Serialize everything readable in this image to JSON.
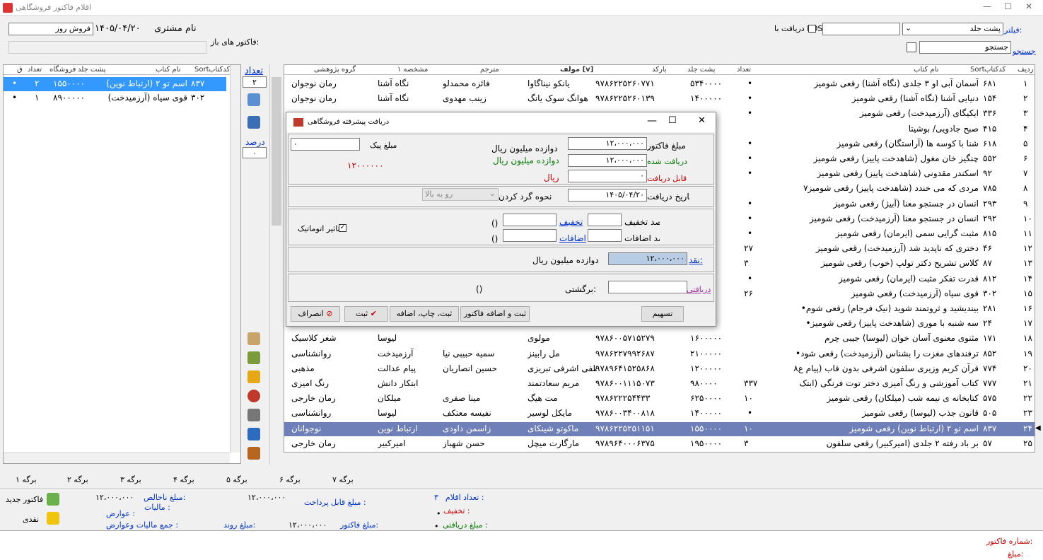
{
  "window": {
    "title": "اقلام فاکتور فروشگاهی",
    "minimize": "—",
    "maximize": "☐",
    "close": "✕"
  },
  "top": {
    "filter_label": "فیلتر:",
    "filter_value": "پشت جلد",
    "filter_text": "",
    "pos_label": "دریافت با POS",
    "day_sale": "فروش روز",
    "date": "۱۴۰۵/۰۴/۲۰",
    "customer_label": "نام مشتری",
    "open_invoices": "فاکتور های باز:",
    "search_label": "جستجو",
    "search_placeholder": "جستجو"
  },
  "main_grid": {
    "headers": [
      "ردیف",
      "کدکتاب",
      "Sort",
      "نام کتاب",
      "تعداد",
      "پشت جلد",
      "بارکد",
      "مولف [v]",
      "مترجم",
      "مشخصه ۱",
      "گروه پژوهشی"
    ],
    "rows": [
      [
        "۱",
        "۶۸۱",
        "آسمان آبی او ۳ جلدی (نگاه آشنا) رقعی شومیز",
        "",
        "۵۳۴۰۰۰۰",
        "۹۷۸۶۲۲۵۲۶۰۷۷۱",
        "یانکو نیناگاوا",
        "فائزه محمدلو",
        "نگاه آشنا",
        "رمان نوجوان",
        "•"
      ],
      [
        "۲",
        "۱۵۴",
        "دنیایی آشنا (نگاه آشنا) رقعی شومیز",
        "",
        "۱۴۰۰۰۰۰",
        "۹۷۸۶۲۲۵۲۶۰۱۳۹",
        "هوانگ سوک یانگ",
        "زینب مهدوی",
        "نگاه آشنا",
        "رمان نوجوان",
        "•"
      ],
      [
        "۳",
        "۳۳۶",
        "ایکیگای (آرزمیدخت) رقعی شومیز",
        "",
        "",
        "",
        "",
        "",
        "",
        "",
        "•"
      ],
      [
        "۴",
        "۴۱۵",
        "صبح جادویی/ بوشیتا",
        "",
        "",
        "",
        "",
        "",
        "",
        "",
        ""
      ],
      [
        "۵",
        "۶۱۸",
        "شنا با کوسه ها (آراستگان) رقعی شومیز",
        "",
        "",
        "",
        "",
        "",
        "",
        "",
        "•"
      ],
      [
        "۶",
        "۵۵۲",
        "چنگیز خان مغول (شاهدخت پاییز) رقعی شومیز",
        "",
        "",
        "",
        "",
        "",
        "",
        "",
        "•"
      ],
      [
        "۷",
        "۹۲",
        "اسکندر مقدونی (شاهدخت پاییز) رقعی شومیز",
        "",
        "",
        "",
        "",
        "",
        "",
        "",
        "•"
      ],
      [
        "۸",
        "۷۸۵",
        "مردی که می خندد (شاهدخت پاییز) رقعی شومیز۷",
        "",
        "",
        "",
        "",
        "",
        "",
        "",
        ""
      ],
      [
        "۹",
        "۲۹۳",
        "انسان در جستجو معنا (آبیژ) رقعی شومیز",
        "",
        "",
        "",
        "",
        "",
        "",
        "",
        "•"
      ],
      [
        "۱۰",
        "۲۹۲",
        "انسان در جستجو معنا (آرزمیدخت) رقعی شومیز",
        "",
        "",
        "",
        "",
        "",
        "",
        "",
        "•"
      ],
      [
        "۱۱",
        "۸۱۵",
        "مثبت گرایی سمی (ایرمان) رقعی شومیز",
        "",
        "",
        "",
        "",
        "",
        "",
        "",
        "•"
      ],
      [
        "۱۲",
        "۴۶",
        "دختری که ناپدید شد (آرزمیدخت) رقعی شومیز",
        "۲۷",
        "",
        "",
        "",
        "",
        "",
        "",
        ""
      ],
      [
        "۱۳",
        "۸۷",
        "کلاس تشریح دکتر تولپ (خوب) رقعی شومیز",
        "۳",
        "",
        "",
        "",
        "",
        "",
        "",
        ""
      ],
      [
        "۱۴",
        "۸۱۲",
        "قدرت تفکر مثبت (ایرمان) رقعی شومیز",
        "",
        "",
        "",
        "",
        "",
        "",
        "",
        "•"
      ],
      [
        "۱۵",
        "۳۰۲",
        "قوی سیاه (آرزمیدخت) رقعی شومیز",
        "۲۶",
        "",
        "",
        "",
        "",
        "",
        "",
        ""
      ],
      [
        "۱۶",
        "۲۸۱",
        "بیندیشید و ثروتمند شوید (نیک فرجام) رقعی شوم•",
        "",
        "",
        "",
        "",
        "",
        "",
        "",
        ""
      ],
      [
        "۱۷",
        "۲۴",
        "سه شنبه با موری (شاهدخت پاییز) رقعی شومیز•",
        "",
        "",
        "",
        "",
        "",
        "",
        "",
        ""
      ],
      [
        "۱۸",
        "۱۷۱",
        "مثنوی معنوی آسان خوان (لیوسا) جیبی چرم",
        "",
        "۱۶۰۰۰۰۰",
        "۹۷۸۶۰۰۵۷۱۵۲۷۹",
        "مولوی",
        "",
        "لیوسا",
        "شعر کلاسیک",
        ""
      ],
      [
        "۱۹",
        "۸۵۲",
        "ترفندهای مغزت را بشناس (آرزمیدخت) رقعی شود•",
        "",
        "۲۱۰۰۰۰۰",
        "۹۷۸۶۲۲۷۹۹۲۶۸۷",
        "مل رابینز",
        "سمیه حبیبی نیا",
        "آرزمیدخت",
        "روانشناسی",
        ""
      ],
      [
        "۲۰",
        "۷۷۴",
        "قرآن کریم وزیری سلفون اشرفی بدون قاب (پیام ع۸",
        "",
        "۱۲۰۰۰۰۰",
        "۹۷۸۹۶۴۱۵۲۵۸۶۸",
        "مصطفی اشرفی تبریزی",
        "حسین انصاریان",
        "پیام عدالت",
        "مذهبی",
        ""
      ],
      [
        "۲۱",
        "۷۷۷",
        "کتاب آموزشی و رنگ آمیزی دختر توت فرنگی (ابتک",
        "۳۳۷",
        "۹۸۰۰۰۰",
        "۹۷۸۶۰۰۱۱۱۵۰۷۳",
        "مریم سعادتمند",
        "",
        "ابتکار دانش",
        "رنگ امیزی",
        ""
      ],
      [
        "۲۲",
        "۵۷۵",
        "کتابخانه ی نیمه شب (میلکان) رقعی شومیز",
        "۱۰",
        "۶۲۵۰۰۰۰",
        "۹۷۸۶۲۲۲۵۴۴۳۳",
        "مت هیگ",
        "مینا صفری",
        "میلکان",
        "رمان خارجی",
        ""
      ],
      [
        "۲۳",
        "۵۰۵",
        "قانون جذب (لیوسا) رقعی شومیز",
        "",
        "۱۴۰۰۰۰۰",
        "۹۷۸۶۰۰۳۴۰۰۸۱۸",
        "مایکل لوسیر",
        "نفیسه معتکف",
        "لیوسا",
        "روانشناسی",
        "•"
      ],
      [
        "۲۴",
        "۸۳۷",
        "اسم تو ۲ (ارتباط نوین) رقعی شومیز",
        "۱۰",
        "۱۵۵۰۰۰۰",
        "۹۷۸۶۲۲۵۲۵۱۱۵۱",
        "ماکوتو شینکای",
        "زاسمن داودی",
        "ارتباط نوین",
        "نوجوانان",
        ""
      ],
      [
        "۲۵",
        "۵۷",
        "بر باد رفته ۲ جلدی (امیرکبیر) رقعی سلفون",
        "۳",
        "۱۹۵۰۰۰۰",
        "۹۷۸۹۶۴۰۰۰۶۳۷۵",
        "مارگارت میچل",
        "حسن شهباز",
        "امیرکبیر",
        "رمان خارجی",
        ""
      ]
    ]
  },
  "side": {
    "count_label": "تعداد",
    "count_value": "۲",
    "percent_label": "درصد",
    "percent_value": "۰"
  },
  "cart": {
    "headers": [
      "کدکتاب",
      "Sort",
      "نام کتاب",
      "پشت جلد",
      "فروشگاه",
      "تعداد",
      "ق"
    ],
    "rows": [
      [
        "۸۳۷",
        "اسم تو ۲ (ارتباط نوین)",
        "۱۵۵۰۰۰۰",
        "۲",
        "•"
      ],
      [
        "۳۰۲",
        "قوی سیاه (آرزمیدخت)",
        "۸۹۰۰۰۰۰",
        "۱",
        "•"
      ]
    ]
  },
  "tabs": [
    "برگه ۱",
    "برگه ۲",
    "برگه ۳",
    "برگه ۴",
    "برگه ۵",
    "برگه ۶",
    "برگه ۷"
  ],
  "footer": {
    "new_invoice": "فاکتور جدید",
    "cash": "نقدی",
    "gross_label": "مبلغ ناخالص:",
    "gross_value": "۱۲،۰۰۰،۰۰۰",
    "tax_label": "مالیات :",
    "tax_value": "•",
    "duties_label": "عوارض :",
    "duties_value": "•",
    "sum_tax_label": "جمع مالیات وعوارض :",
    "payable_label": "مبلغ قابل پرداخت :",
    "payable_value": "۱۲،۰۰۰،۰۰۰",
    "invoice_amount_label": "مبلغ فاکتور:",
    "invoice_amount_value": "۱۲،۰۰۰،۰۰۰",
    "round_label": "مبلغ روند:",
    "items_label": "تعداد اقلام :",
    "items_value": "۳",
    "discount_label": "تخفیف :",
    "discount_value": "•",
    "received_label": "مبلغ دریافتی :",
    "received_value": "•",
    "invoice_no_label": "شماره فاکتور:",
    "amount_label": "مبلغ:"
  },
  "dialog": {
    "title": "دریافت پیشرفته فروشگاهی",
    "invoice_amount_label": "مبلغ فاکتور",
    "invoice_amount": "۱۲،۰۰۰،۰۰۰",
    "invoice_words": "دوازده میلیون ریال",
    "received_label": "مبلغ دریافت شده",
    "received_amount": "۱۲،۰۰۰،۰۰۰",
    "received_words": "دوازده میلیون ریال",
    "remaining_label": "مانده قابل دریافت",
    "remaining_amount": "۰",
    "remaining_words": "ریال",
    "courier_label": "مبلغ پیک",
    "courier_value": "۰",
    "red_total": "۱۲۰۰۰۰۰۰",
    "date_label": "تاریخ دریافت",
    "date_value": "۱۴۰۵/۰۴/۲۰",
    "round_label": "نحوه گرد کردن",
    "round_value": "رو به بالا",
    "discount_pct_label": "درصد تخفیف",
    "discount_link": "تخفیف",
    "extra_pct_label": "درصد اضافات",
    "extra_link": "اضافات",
    "paren1": "()",
    "paren2": "()",
    "auto_label": "تاثیر اتوماتیک",
    "cash_label": "نقد:",
    "cash_value": "۱۲،۰۰۰،۰۰۰",
    "cash_words": "دوازده میلیون ریال",
    "change_label": "برگشتی:",
    "received_link": "دریافتی",
    "paren3": "()",
    "btn_split": "تسهیم",
    "btn_save_add": "ثبت و اضافه فاکتور",
    "btn_save_print": "ثبت، چاپ، اضافه",
    "btn_save": "ثبت",
    "btn_cancel": "انصراف"
  }
}
